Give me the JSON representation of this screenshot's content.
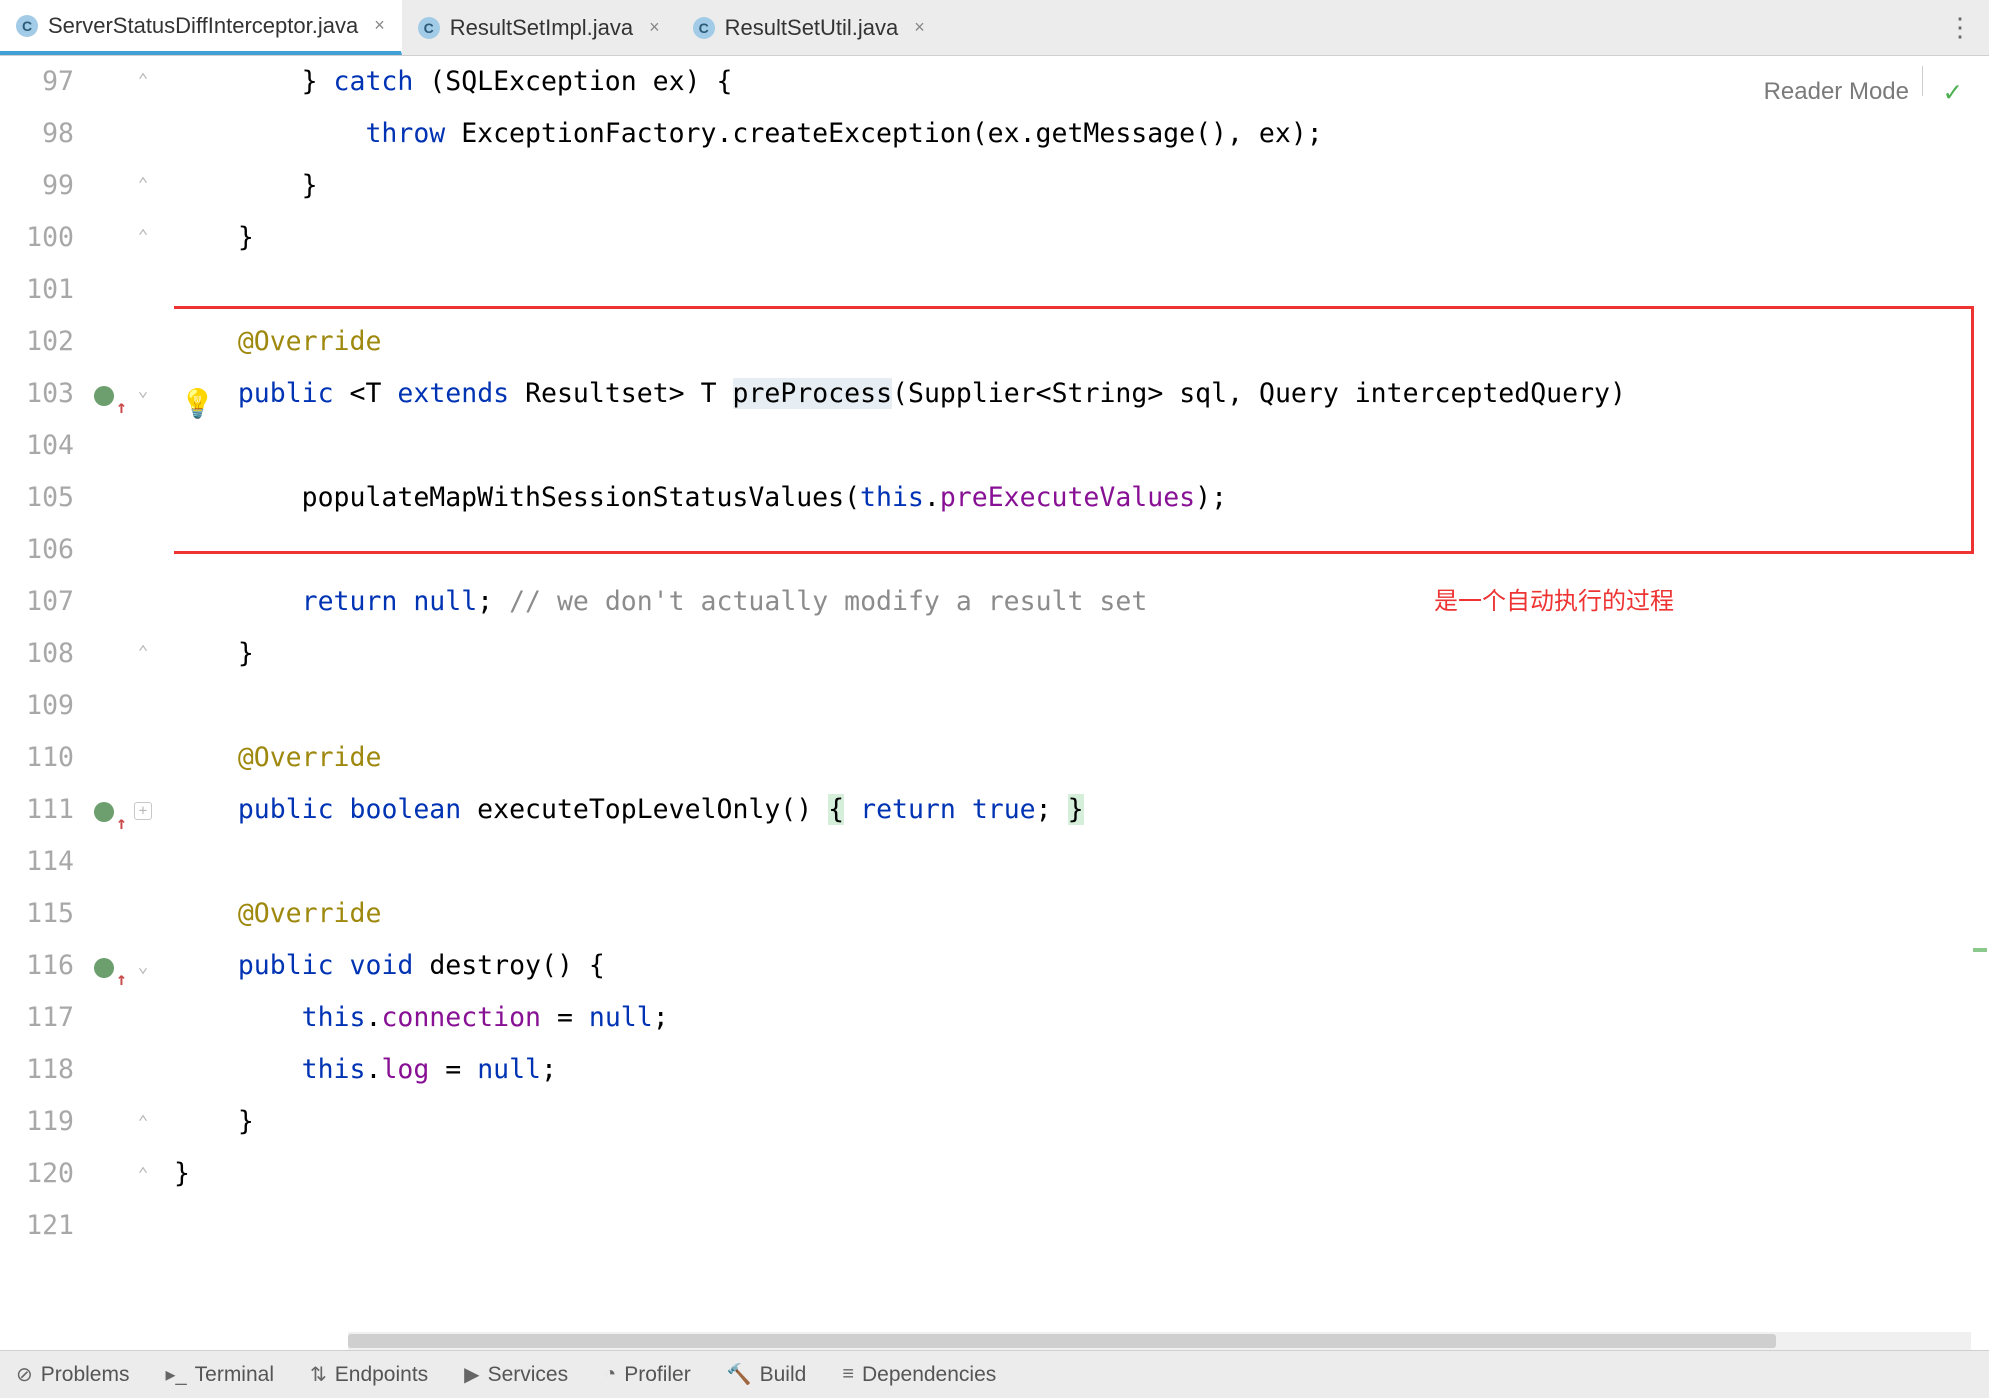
{
  "tabs": [
    {
      "label": "ServerStatusDiffInterceptor.java",
      "active": true
    },
    {
      "label": "ResultSetImpl.java",
      "active": false
    },
    {
      "label": "ResultSetUtil.java",
      "active": false
    }
  ],
  "reader_mode": "Reader Mode",
  "annotation_text": "是一个自动执行的过程",
  "lines": {
    "start": 97,
    "numbers": [
      "97",
      "98",
      "99",
      "100",
      "101",
      "102",
      "103",
      "104",
      "105",
      "106",
      "107",
      "108",
      "109",
      "110",
      "111",
      "114",
      "115",
      "116",
      "117",
      "118",
      "119",
      "120",
      "121"
    ]
  },
  "code": {
    "l97_a": "        } ",
    "l97_kw": "catch",
    "l97_b": " (SQLException ex) {",
    "l98_a": "            ",
    "l98_kw": "throw",
    "l98_b": " ExceptionFactory.createException(ex.getMessage(), ex);",
    "l99": "        }",
    "l100": "    }",
    "l101": "",
    "l102_ann": "    @Override",
    "l103_a": "    ",
    "l103_kw1": "public",
    "l103_b": " <",
    "l103_tp": "T",
    "l103_c": " ",
    "l103_kw2": "extends",
    "l103_d": " Resultset> ",
    "l103_tp2": "T",
    "l103_e": " ",
    "l103_mtd": "preProcess",
    "l103_f": "(Supplier<String> sql, Query interceptedQuery)",
    "l104": "",
    "l105_a": "        populateMapWithSessionStatusValues(",
    "l105_kw": "this",
    "l105_b": ".",
    "l105_fld": "preExecuteValues",
    "l105_c": ");",
    "l106": "",
    "l107_a": "        ",
    "l107_kw": "return",
    "l107_b": " ",
    "l107_kw2": "null",
    "l107_c": "; ",
    "l107_cmt": "// we don't actually modify a result set",
    "l108": "    }",
    "l109": "",
    "l110_ann": "    @Override",
    "l111_a": "    ",
    "l111_kw1": "public",
    "l111_b": " ",
    "l111_kw2": "boolean",
    "l111_c": " executeTopLevelOnly() ",
    "l111_hl1": "{",
    "l111_d": " ",
    "l111_kw3": "return",
    "l111_e": " ",
    "l111_kw4": "true",
    "l111_f": "; ",
    "l111_hl2": "}",
    "l114": "",
    "l115_ann": "    @Override",
    "l116_a": "    ",
    "l116_kw1": "public",
    "l116_b": " ",
    "l116_kw2": "void",
    "l116_c": " destroy() {",
    "l117_a": "        ",
    "l117_kw": "this",
    "l117_b": ".",
    "l117_fld": "connection",
    "l117_c": " = ",
    "l117_kw2": "null",
    "l117_d": ";",
    "l118_a": "        ",
    "l118_kw": "this",
    "l118_b": ".",
    "l118_fld": "log",
    "l118_c": " = ",
    "l118_kw2": "null",
    "l118_d": ";",
    "l119": "    }",
    "l120": "}",
    "l121": ""
  },
  "bottom": {
    "problems": "Problems",
    "terminal": "Terminal",
    "endpoints": "Endpoints",
    "services": "Services",
    "profiler": "Profiler",
    "build": "Build",
    "dependencies": "Dependencies"
  },
  "icons": {
    "file": "C",
    "close": "×",
    "kebab": "⋮",
    "check": "✓",
    "bulb": "💡",
    "problems": "⊘",
    "terminal": "▸_",
    "endpoints": "⇅",
    "services": "▶",
    "profiler": "◔",
    "build": "🔨",
    "deps": "≡"
  }
}
